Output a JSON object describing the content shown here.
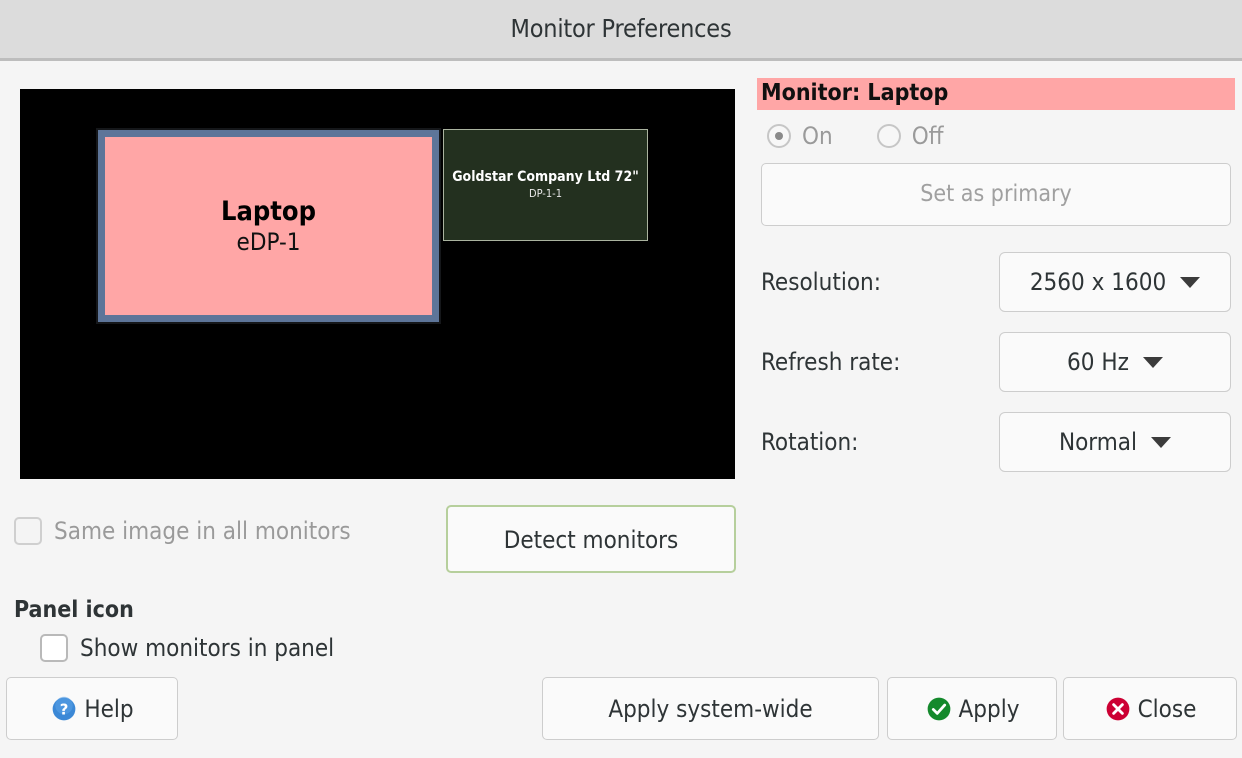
{
  "window": {
    "title": "Monitor Preferences"
  },
  "preview": {
    "background": "#000000",
    "monitors": [
      {
        "name": "Laptop",
        "output": "eDP-1",
        "state": "selected",
        "fill": "#ffa6a6",
        "frame": "#5d7599"
      },
      {
        "name": "Goldstar Company Ltd 72\"",
        "output": "DP-1-1",
        "state": "inactive",
        "fill": "#23301f",
        "frame": "#aab39f"
      }
    ]
  },
  "panel": {
    "heading": "Monitor: Laptop",
    "heading_bg": "#ffa6a6",
    "power": {
      "on_label": "On",
      "off_label": "Off",
      "selected": "On"
    },
    "set_primary_label": "Set as primary",
    "fields": [
      {
        "label": "Resolution:",
        "value": "2560 x 1600"
      },
      {
        "label": "Refresh rate:",
        "value": "60 Hz"
      },
      {
        "label": "Rotation:",
        "value": "Normal"
      }
    ]
  },
  "options": {
    "same_image_label": "Same image in all monitors",
    "same_image_checked": false,
    "detect_monitors_label": "Detect monitors",
    "detect_focus_color": "#b6cf9c",
    "panel_icon_title": "Panel icon",
    "show_monitors_label": "Show monitors in panel",
    "show_monitors_checked": false
  },
  "actions": {
    "help_label": "Help",
    "help_icon": "help-circle-icon",
    "help_icon_color": "#3b88d6",
    "apply_wide_label": "Apply system-wide",
    "apply_label": "Apply",
    "apply_icon": "check-circle-icon",
    "apply_icon_color": "#14892c",
    "close_label": "Close",
    "close_icon": "cancel-circle-icon",
    "close_icon_color": "#cc0033"
  }
}
